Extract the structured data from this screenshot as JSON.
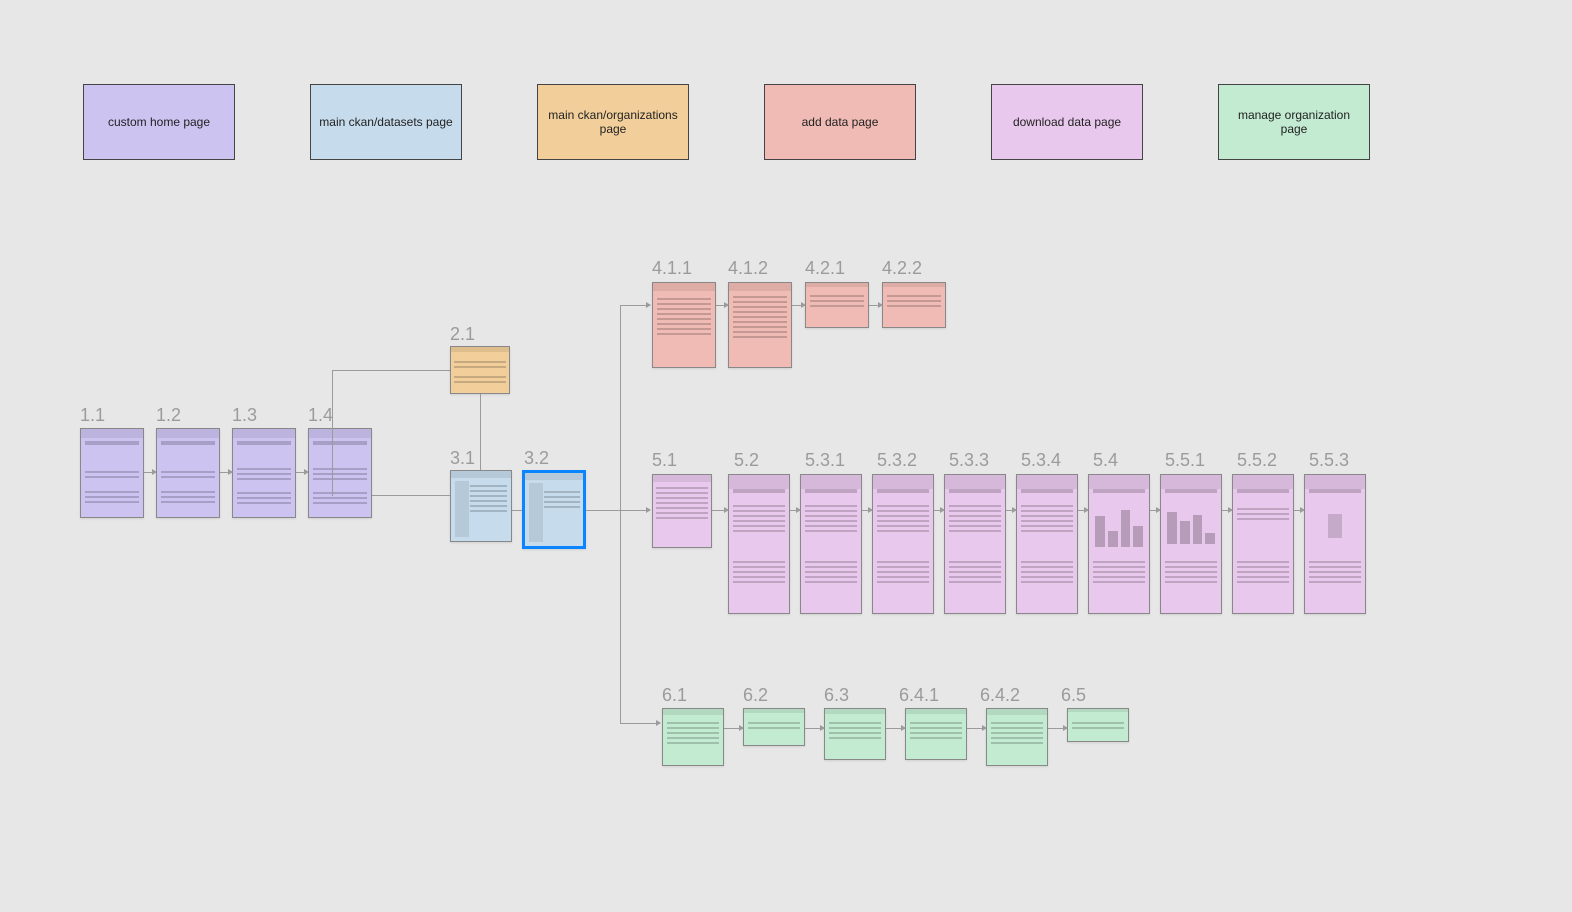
{
  "legend": {
    "custom_home": "custom home page",
    "datasets": "main ckan/datasets page",
    "organizations": "main ckan/organizations page",
    "add_data": "add data page",
    "download": "download data page",
    "manage_org": "manage organization page"
  },
  "labels": {
    "n1_1": "1.1",
    "n1_2": "1.2",
    "n1_3": "1.3",
    "n1_4": "1.4",
    "n2_1": "2.1",
    "n3_1": "3.1",
    "n3_2": "3.2",
    "n4_1_1": "4.1.1",
    "n4_1_2": "4.1.2",
    "n4_2_1": "4.2.1",
    "n4_2_2": "4.2.2",
    "n5_1": "5.1",
    "n5_2": "5.2",
    "n5_3_1": "5.3.1",
    "n5_3_2": "5.3.2",
    "n5_3_3": "5.3.3",
    "n5_3_4": "5.3.4",
    "n5_4": "5.4",
    "n5_5_1": "5.5.1",
    "n5_5_2": "5.5.2",
    "n5_5_3": "5.5.3",
    "n6_1": "6.1",
    "n6_2": "6.2",
    "n6_3": "6.3",
    "n6_4_1": "6.4.1",
    "n6_4_2": "6.4.2",
    "n6_5": "6.5"
  },
  "colors": {
    "purple": "#ccc3f1",
    "blue": "#c6dbec",
    "orange": "#f2cf9a",
    "red": "#f0bbb4",
    "violet": "#e9c8ed",
    "green": "#c2ebd1"
  },
  "selected_node": "3.2",
  "sitemap": {
    "1": {
      "count": 4,
      "page_type": "custom home page"
    },
    "2": {
      "count": 1,
      "page_type": "main ckan/organizations page"
    },
    "3": {
      "count": 2,
      "page_type": "main ckan/datasets page"
    },
    "4": {
      "count": 4,
      "page_type": "add data page"
    },
    "5": {
      "count": 10,
      "page_type": "download data page"
    },
    "6": {
      "count": 6,
      "page_type": "manage organization page"
    }
  }
}
